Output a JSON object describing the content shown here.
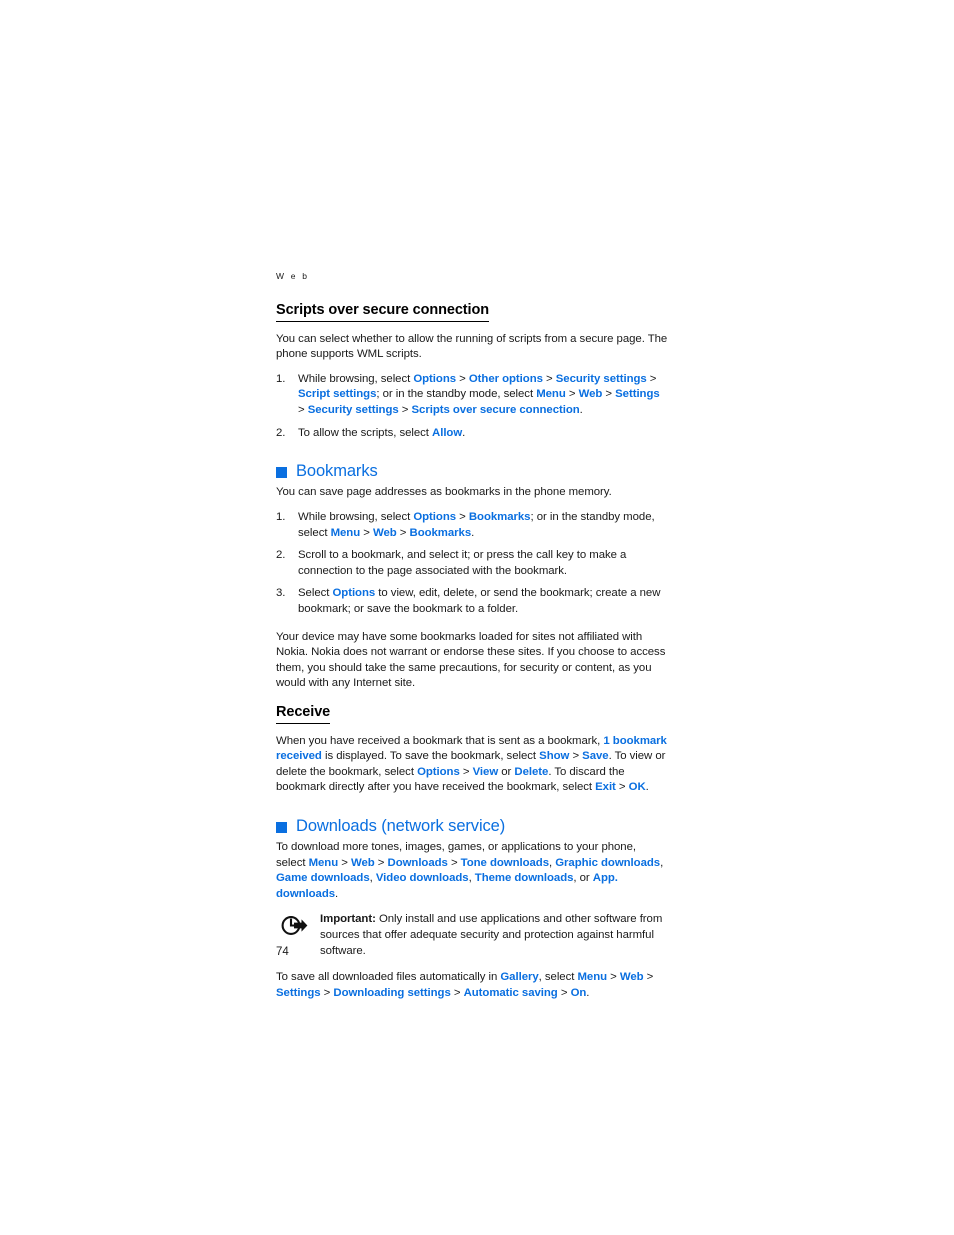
{
  "page": {
    "running_head": "W e b",
    "folio": "74",
    "accent_color": "#0a6fe0",
    "text_color": "#1a1a1a"
  },
  "scripts_section": {
    "heading": "Scripts over secure connection",
    "intro": "You can select whether to allow the running of scripts from a secure page. The phone supports WML scripts.",
    "steps": [
      {
        "number": "1.",
        "parts": [
          {
            "t": "While browsing, select ",
            "style": "plain"
          },
          {
            "t": "Options",
            "style": "ui"
          },
          {
            "t": " > ",
            "style": "sep"
          },
          {
            "t": "Other options",
            "style": "ui"
          },
          {
            "t": " > ",
            "style": "sep"
          },
          {
            "t": "Security settings",
            "style": "ui"
          },
          {
            "t": " > ",
            "style": "sep"
          },
          {
            "t": "Script settings",
            "style": "ui"
          },
          {
            "t": "; or in the standby mode, select ",
            "style": "plain"
          },
          {
            "t": "Menu",
            "style": "ui"
          },
          {
            "t": " > ",
            "style": "sep"
          },
          {
            "t": "Web",
            "style": "ui"
          },
          {
            "t": " > ",
            "style": "sep"
          },
          {
            "t": "Settings",
            "style": "ui"
          },
          {
            "t": " > ",
            "style": "sep"
          },
          {
            "t": "Security settings",
            "style": "ui"
          },
          {
            "t": " > ",
            "style": "sep"
          },
          {
            "t": "Scripts over secure connection",
            "style": "ui"
          },
          {
            "t": ".",
            "style": "plain"
          }
        ]
      },
      {
        "number": "2.",
        "parts": [
          {
            "t": "To allow the scripts, select ",
            "style": "plain"
          },
          {
            "t": "Allow",
            "style": "ui"
          },
          {
            "t": ".",
            "style": "plain"
          }
        ]
      }
    ]
  },
  "bookmarks_section": {
    "heading": "Bookmarks",
    "bullet": "blue-square",
    "intro": "You can save page addresses as bookmarks in the phone memory.",
    "steps": [
      {
        "number": "1.",
        "parts": [
          {
            "t": "While browsing, select ",
            "style": "plain"
          },
          {
            "t": "Options",
            "style": "ui"
          },
          {
            "t": " > ",
            "style": "sep"
          },
          {
            "t": "Bookmarks",
            "style": "ui"
          },
          {
            "t": "; or in the standby mode, select ",
            "style": "plain"
          },
          {
            "t": "Menu",
            "style": "ui"
          },
          {
            "t": " > ",
            "style": "sep"
          },
          {
            "t": "Web",
            "style": "ui"
          },
          {
            "t": " > ",
            "style": "sep"
          },
          {
            "t": "Bookmarks",
            "style": "ui"
          },
          {
            "t": ".",
            "style": "plain"
          }
        ]
      },
      {
        "number": "2.",
        "parts": [
          {
            "t": "Scroll to a bookmark, and select it; or press the call key to make a connection to the page associated with the bookmark.",
            "style": "plain"
          }
        ]
      },
      {
        "number": "3.",
        "parts": [
          {
            "t": "Select ",
            "style": "plain"
          },
          {
            "t": "Options",
            "style": "ui"
          },
          {
            "t": " to view, edit, delete, or send the bookmark; create a new bookmark; or save the bookmark to a folder.",
            "style": "plain"
          }
        ]
      }
    ],
    "disclaimer": "Your device may have some bookmarks loaded for sites not affiliated with Nokia. Nokia does not warrant or endorse these sites. If you choose to access them, you should take the same precautions, for security or content, as you would with any Internet site."
  },
  "receive_section": {
    "heading": "Receive",
    "parts": [
      {
        "t": "When you have received a bookmark that is sent as a bookmark, ",
        "style": "plain"
      },
      {
        "t": "1 bookmark received",
        "style": "ui"
      },
      {
        "t": " is displayed. To save the bookmark, select ",
        "style": "plain"
      },
      {
        "t": "Show",
        "style": "ui"
      },
      {
        "t": " > ",
        "style": "sep"
      },
      {
        "t": "Save",
        "style": "ui"
      },
      {
        "t": ". To view or delete the bookmark, select ",
        "style": "plain"
      },
      {
        "t": "Options",
        "style": "ui"
      },
      {
        "t": " > ",
        "style": "sep"
      },
      {
        "t": "View",
        "style": "ui"
      },
      {
        "t": " or ",
        "style": "plain"
      },
      {
        "t": "Delete",
        "style": "ui"
      },
      {
        "t": ". To discard the bookmark directly after you have received the bookmark, select ",
        "style": "plain"
      },
      {
        "t": "Exit",
        "style": "ui"
      },
      {
        "t": " > ",
        "style": "sep"
      },
      {
        "t": "OK",
        "style": "ui"
      },
      {
        "t": ".",
        "style": "plain"
      }
    ]
  },
  "downloads_section": {
    "heading": "Downloads (network service)",
    "bullet": "blue-square",
    "intro_parts": [
      {
        "t": "To download more tones, images, games, or applications to your phone, select ",
        "style": "plain"
      },
      {
        "t": "Menu",
        "style": "ui"
      },
      {
        "t": " > ",
        "style": "sep"
      },
      {
        "t": "Web",
        "style": "ui"
      },
      {
        "t": " > ",
        "style": "sep"
      },
      {
        "t": "Downloads",
        "style": "ui"
      },
      {
        "t": " > ",
        "style": "sep"
      },
      {
        "t": "Tone downloads",
        "style": "ui"
      },
      {
        "t": ", ",
        "style": "sep"
      },
      {
        "t": "Graphic downloads",
        "style": "ui"
      },
      {
        "t": ", ",
        "style": "sep"
      },
      {
        "t": "Game downloads",
        "style": "ui"
      },
      {
        "t": ", ",
        "style": "sep"
      },
      {
        "t": "Video downloads",
        "style": "ui"
      },
      {
        "t": ", ",
        "style": "sep"
      },
      {
        "t": "Theme downloads",
        "style": "ui"
      },
      {
        "t": ", or ",
        "style": "plain"
      },
      {
        "t": "App. downloads",
        "style": "ui"
      },
      {
        "t": ".",
        "style": "plain"
      }
    ],
    "note": {
      "icon": "important-arrow-icon",
      "label": "Important:",
      "text": " Only install and use applications and other software from sources that offer adequate security and protection against harmful software."
    },
    "outro_parts": [
      {
        "t": "To save all downloaded files automatically in ",
        "style": "plain"
      },
      {
        "t": "Gallery",
        "style": "ui"
      },
      {
        "t": ", select ",
        "style": "plain"
      },
      {
        "t": "Menu",
        "style": "ui"
      },
      {
        "t": " > ",
        "style": "sep"
      },
      {
        "t": "Web",
        "style": "ui"
      },
      {
        "t": " > ",
        "style": "sep"
      },
      {
        "t": "Settings",
        "style": "ui"
      },
      {
        "t": " > ",
        "style": "sep"
      },
      {
        "t": "Downloading settings",
        "style": "ui"
      },
      {
        "t": " > ",
        "style": "sep"
      },
      {
        "t": "Automatic saving",
        "style": "ui"
      },
      {
        "t": " > ",
        "style": "sep"
      },
      {
        "t": "On",
        "style": "ui"
      },
      {
        "t": ".",
        "style": "plain"
      }
    ]
  }
}
